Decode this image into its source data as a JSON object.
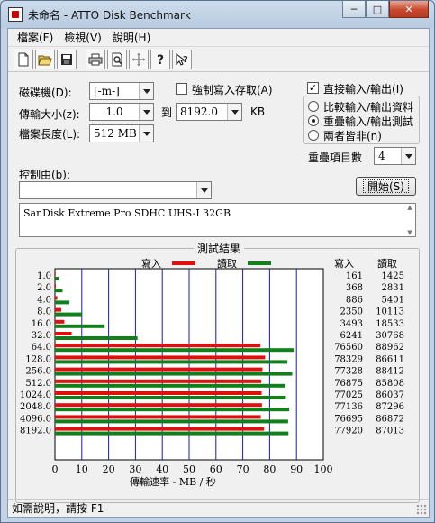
{
  "window": {
    "title": "未命名 - ATTO Disk Benchmark",
    "caption_buttons": [
      "─",
      "□",
      "✕"
    ]
  },
  "menu": [
    "檔案(F)",
    "檢視(V)",
    "說明(H)"
  ],
  "toolbar_icons": [
    "new-file-icon",
    "open-folder-icon",
    "save-icon",
    "print-icon",
    "print-preview-icon",
    "move-icon",
    "help-icon",
    "context-help-icon"
  ],
  "settings": {
    "drive_label": "磁碟機(D):",
    "drive_value": "[-m-]",
    "transfer_size_label": "傳輸大小(z):",
    "transfer_from": "1.0",
    "to_label": "到",
    "transfer_to": "8192.0",
    "unit": "KB",
    "file_length_label": "檔案長度(L):",
    "file_length": "512 MB",
    "force_write_label": "強制寫入存取(A)",
    "force_write_checked": false,
    "direct_io_label": "直接輸入/輸出(I)",
    "direct_io_checked": true,
    "radio_options": [
      "比較輸入/輸出資料",
      "重疊輸入/輸出測試",
      "兩者皆非(n)"
    ],
    "radio_selected": 1,
    "queue_depth_label": "重疊項目數",
    "queue_depth": "4",
    "controlled_by_label": "控制由(b):",
    "controlled_by_value": "",
    "start_button": "開始(S)",
    "description": "SanDisk Extreme Pro SDHC UHS-I 32GB"
  },
  "results": {
    "title": "測試結果",
    "legend_write": "寫入",
    "legend_read": "讀取",
    "col_write": "寫入",
    "col_read": "讀取",
    "colors": {
      "write": "#e01010",
      "read": "#10801a"
    }
  },
  "chart_data": {
    "type": "bar",
    "orientation": "horizontal",
    "categories": [
      "1.0",
      "2.0",
      "4.0",
      "8.0",
      "16.0",
      "32.0",
      "64.0",
      "128.0",
      "256.0",
      "512.0",
      "1024.0",
      "2048.0",
      "4096.0",
      "8192.0"
    ],
    "series": [
      {
        "name": "寫入",
        "values": [
          161,
          368,
          886,
          2350,
          3493,
          6241,
          76560,
          78329,
          77328,
          76875,
          77025,
          77136,
          76695,
          77920
        ]
      },
      {
        "name": "讀取",
        "values": [
          1425,
          2831,
          5401,
          10113,
          18533,
          30768,
          88962,
          86611,
          88412,
          85808,
          86037,
          87296,
          86872,
          87013
        ]
      }
    ],
    "x_ticks": [
      "0",
      "10",
      "20",
      "30",
      "40",
      "50",
      "60",
      "70",
      "80",
      "90",
      "100"
    ],
    "xlabel": "傳輸速率 - MB / 秒",
    "xlim": [
      0,
      100
    ],
    "grid": true
  },
  "status": {
    "text": "如需說明，請按 F1"
  }
}
